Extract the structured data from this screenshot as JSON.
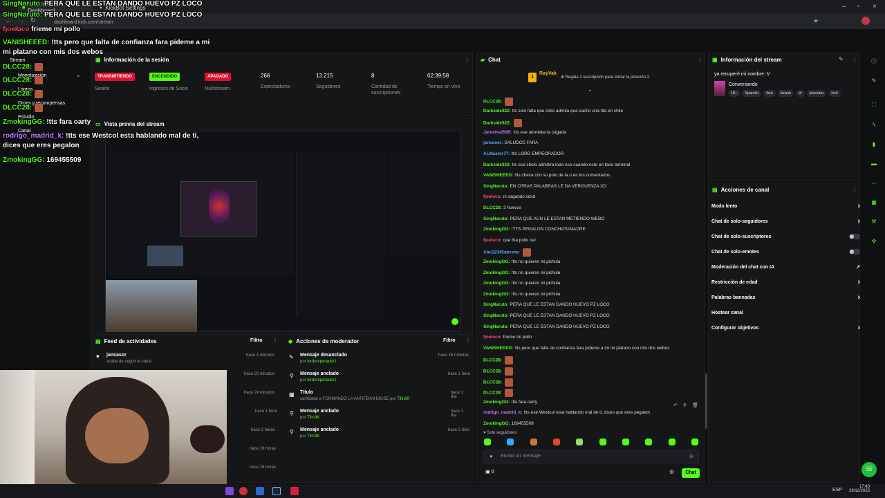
{
  "browser": {
    "tabs": [
      "Stream – Kick Dashboard",
      "KickBot Settings"
    ],
    "url": "dashboard.kick.com/stream"
  },
  "sidebar": {
    "items": [
      "Stream",
      "Monetización",
      "Logros",
      "Drops y recompensas",
      "Estudio",
      "Canal"
    ]
  },
  "session": {
    "title": "Información de la sesión",
    "session_badge": "TRANSMITIENDO",
    "session_label": "Sesión",
    "income_badge": "ENCENDIDO",
    "income_label": "Ingresos de Socio",
    "multistream_badge": "APAGADO",
    "multistream_label": "Multistream",
    "viewers": "266",
    "viewers_label": "Espectadores",
    "followers": "13.215",
    "followers_label": "Seguidores",
    "subs": "8",
    "subs_label": "Cantidad de suscripciones",
    "time": "02:39:58",
    "time_label": "Tiempo en vivo"
  },
  "preview": {
    "title": "Vista previa del stream"
  },
  "overlay": [
    {
      "user": "SingNaruto:",
      "msg": " PERA QUE LE ESTAN DANDO HUEVO PZ LOCO"
    },
    {
      "user": "SingNaruto:",
      "msg": " PERA QUE LE ESTAN DANDO HUEVO PZ LOCO"
    },
    {
      "user": "fjoeluco",
      "msg": " frieme mi pollo"
    },
    {
      "user": "VANISHEEED:",
      "msg": " !tts pero que falta de confianza fara pideme a mi"
    },
    {
      "user": "",
      "msg": "mi platano con mis dos webos"
    },
    {
      "user": "DLCC28:",
      "msg": ""
    },
    {
      "user": "DLCC28:",
      "msg": ""
    },
    {
      "user": "DLCC28:",
      "msg": ""
    },
    {
      "user": "DLCC28:",
      "msg": ""
    },
    {
      "user": "ZmokingGG:",
      "msg": " !tts fara oarty"
    },
    {
      "user": "rodrigo_madrid_k:",
      "msg": " !tts ese Westcol esta hablando mal de ti,"
    },
    {
      "user": "",
      "msg": "dices que eres pegalon"
    },
    {
      "user": "ZmokingGG:",
      "msg": " 169455509"
    }
  ],
  "feed": {
    "title": "Feed de actividades",
    "filter": "Filtro",
    "first_user": "jancasor",
    "first_action": "acaba de seguir el canal",
    "times": [
      "hace 4 minutos",
      "hace 20 minutos",
      "hace 24 minutos",
      "hace 1 hora",
      "hace 2 horas",
      "hace 16 horas",
      "hace 16 horas"
    ]
  },
  "mod": {
    "title": "Acciones de moderador",
    "filter": "Filtro",
    "rows": [
      {
        "title": "Mensaje desanclado",
        "pre": "por",
        "by": "lordemperador1",
        "time": "hace 16 minutos"
      },
      {
        "title": "Mensaje anclado",
        "pre": "por",
        "by": "lordemperador1",
        "time": "hace 1 hora"
      },
      {
        "title": "Título",
        "pre": "cambiado a FORMANDO LA ANTIFEKAHOUSE por",
        "by": "Tilin3K",
        "time": "hace 1 día"
      },
      {
        "title": "Mensaje anclado",
        "pre": "por",
        "by": "Tilin3K",
        "time": "hace 1 día"
      },
      {
        "title": "Mensaje anclado",
        "pre": "por",
        "by": "Tilin3K",
        "time": "hace 2 días"
      }
    ]
  },
  "chat": {
    "title": "Chat",
    "top_user": "RayVak",
    "gift_text": "Regala 1 suscripción para tomar la posición 2",
    "messages": [
      {
        "user": "DLCC28:",
        "color": "#53fc18",
        "msg": ""
      },
      {
        "user": "Darkside322:",
        "color": "#53fc18",
        "msg": "tts solo falta que cirilo admita que cacho una tita en chile"
      },
      {
        "user": "Darkside322:",
        "color": "#53fc18",
        "msg": ""
      },
      {
        "user": "Jarocho2595:",
        "color": "#c37bff",
        "msg": "!tts ese aborteka la cagada"
      },
      {
        "user": "jancasor:",
        "color": "#4ea6ff",
        "msg": "SALUDOS FARA"
      },
      {
        "user": "ALMaster77:",
        "color": "#4ea6ff",
        "msg": "!tts LORD EMPEORADOR"
      },
      {
        "user": "Darkside322:",
        "color": "#53fc18",
        "msg": "tts ese cholo admitira todo eso cuando este en fase terminal"
      },
      {
        "user": "VANISHEEED:",
        "color": "#53fc18",
        "msg": "!tts checa con su polo de la u en los comentarios"
      },
      {
        "user": "SingNaruto:",
        "color": "#53fc18",
        "msg": "EN OTRAS PALABRAS LE DA VERGUENZA XD"
      },
      {
        "user": "fjoeluco:",
        "color": "#ff4f6d",
        "msg": "ni cagando xdxd"
      },
      {
        "user": "DLCC28:",
        "color": "#53fc18",
        "msg": "3 huevos"
      },
      {
        "user": "SingNaruto:",
        "color": "#53fc18",
        "msg": "PERA QUE AUN LE ESTAN METIENDO WEBO"
      },
      {
        "user": "ZmokingGG:",
        "color": "#53fc18",
        "msg": "!TTS PEGALON CONCHATUMADRE"
      },
      {
        "user": "fjoeluco:",
        "color": "#ff4f6d",
        "msg": "que fria pollo oe!"
      },
      {
        "user": "Abc12345abcww:",
        "color": "#4ea6ff",
        "msg": ""
      },
      {
        "user": "ZmokingGG:",
        "color": "#53fc18",
        "msg": "!tts no quieres mi pichula"
      },
      {
        "user": "ZmokingGG:",
        "color": "#53fc18",
        "msg": "!tts no quieres mi pichula"
      },
      {
        "user": "ZmokingGG:",
        "color": "#53fc18",
        "msg": "!tts no quieres mi pichula"
      },
      {
        "user": "ZmokingGG:",
        "color": "#53fc18",
        "msg": "!tts no quieres mi pichula"
      },
      {
        "user": "SingNaruto:",
        "color": "#53fc18",
        "msg": "PERA QUE LE ESTAN DANDO HUEVO PZ LOCO"
      },
      {
        "user": "SingNaruto:",
        "color": "#53fc18",
        "msg": "PERA QUE LE ESTAN DANDO HUEVO PZ LOCO"
      },
      {
        "user": "SingNaruto:",
        "color": "#53fc18",
        "msg": "PERA QUE LE ESTAN DANDO HUEVO PZ LOCO"
      },
      {
        "user": "fjoeluco:",
        "color": "#ff4f6d",
        "msg": "frieme mi pollo"
      },
      {
        "user": "VANISHEEED:",
        "color": "#53fc18",
        "msg": "!tts pero que falta de confianza fara pideme a mi mi platano con mis dos webos"
      },
      {
        "user": "DLCC28:",
        "color": "#53fc18",
        "msg": ""
      },
      {
        "user": "DLCC28:",
        "color": "#53fc18",
        "msg": ""
      },
      {
        "user": "DLCC28:",
        "color": "#53fc18",
        "msg": ""
      },
      {
        "user": "DLCC28:",
        "color": "#53fc18",
        "msg": ""
      },
      {
        "user": "ZmokingGG:",
        "color": "#53fc18",
        "msg": "!tts fara oarty"
      },
      {
        "user": "rodrigo_madrid_k:",
        "color": "#c37bff",
        "msg": "!tts ese Westcol esta hablando mal de ti, dices que eres pegalon"
      },
      {
        "user": "ZmokingGG:",
        "color": "#53fc18",
        "msg": "169455509"
      }
    ],
    "followers_only": "Solo seguidores",
    "input_placeholder": "Enviar un mensaje",
    "counter": "0",
    "send_label": "Chat"
  },
  "stream_info": {
    "title": "Información del stream",
    "stream_title": "ya recuperé mi nombre :V",
    "category": "Conversando",
    "tags": [
      "18+",
      "Spanish",
      "fara",
      "faraon",
      "irl",
      "jescobar",
      "lord"
    ]
  },
  "channel_actions": {
    "title": "Acciones de canal",
    "items": [
      {
        "label": "Modo lento",
        "type": "arrow"
      },
      {
        "label": "Chat de solo-seguidores",
        "type": "arrow"
      },
      {
        "label": "Chat de solo-suscriptores",
        "type": "toggle"
      },
      {
        "label": "Chat de solo-emotes",
        "type": "toggle"
      },
      {
        "label": "Moderación del chat con IA",
        "type": "ext"
      },
      {
        "label": "Restricción de edad",
        "type": "arrow"
      },
      {
        "label": "Palabras baneadas",
        "type": "arrow"
      },
      {
        "label": "Hostear canal",
        "type": "none"
      },
      {
        "label": "Configurar objetivos",
        "type": "arrow"
      }
    ]
  },
  "taskbar": {
    "lang": "ESP",
    "time": "17:43",
    "date": "29/12/2025"
  },
  "colors": {
    "accent": "#53fc18",
    "live": "#e0102a",
    "bg": "#0f1012",
    "panel": "#151618"
  }
}
